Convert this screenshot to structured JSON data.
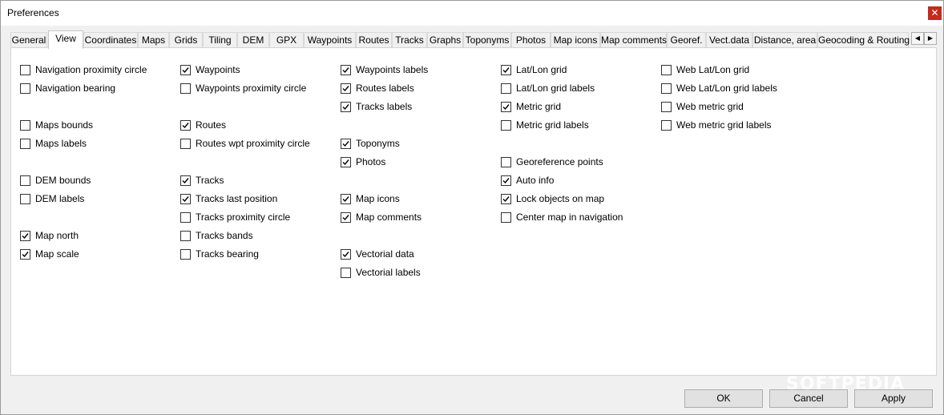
{
  "window": {
    "title": "Preferences",
    "close_glyph": "✕"
  },
  "tabs": [
    {
      "label": "General"
    },
    {
      "label": "View",
      "active": true
    },
    {
      "label": "Coordinates"
    },
    {
      "label": "Maps"
    },
    {
      "label": "Grids"
    },
    {
      "label": "Tiling"
    },
    {
      "label": "DEM"
    },
    {
      "label": "GPX"
    },
    {
      "label": "Waypoints"
    },
    {
      "label": "Routes"
    },
    {
      "label": "Tracks"
    },
    {
      "label": "Graphs"
    },
    {
      "label": "Toponyms"
    },
    {
      "label": "Photos"
    },
    {
      "label": "Map icons"
    },
    {
      "label": "Map comments"
    },
    {
      "label": "Georef."
    },
    {
      "label": "Vect.data"
    },
    {
      "label": "Distance, area"
    },
    {
      "label": "Geocoding & Routing"
    }
  ],
  "tab_scroll": {
    "left_glyph": "◀",
    "right_glyph": "▶"
  },
  "options": {
    "col1": [
      {
        "label": "Navigation proximity circle",
        "checked": false
      },
      {
        "label": "Navigation bearing",
        "checked": false
      },
      {
        "label": "Maps bounds",
        "checked": false
      },
      {
        "label": "Maps labels",
        "checked": false
      },
      {
        "label": "DEM bounds",
        "checked": false
      },
      {
        "label": "DEM labels",
        "checked": false
      },
      {
        "label": "Map north",
        "checked": true
      },
      {
        "label": "Map scale",
        "checked": true
      }
    ],
    "col2": [
      {
        "label": "Waypoints",
        "checked": true
      },
      {
        "label": "Waypoints proximity circle",
        "checked": false
      },
      {
        "label": "Routes",
        "checked": true
      },
      {
        "label": "Routes wpt proximity circle",
        "checked": false
      },
      {
        "label": "Tracks",
        "checked": true
      },
      {
        "label": "Tracks last position",
        "checked": true
      },
      {
        "label": "Tracks proximity circle",
        "checked": false
      },
      {
        "label": "Tracks bands",
        "checked": false
      },
      {
        "label": "Tracks bearing",
        "checked": false
      }
    ],
    "col3": [
      {
        "label": "Waypoints labels",
        "checked": true
      },
      {
        "label": "Routes labels",
        "checked": true
      },
      {
        "label": "Tracks labels",
        "checked": true
      },
      {
        "label": "Toponyms",
        "checked": true
      },
      {
        "label": "Photos",
        "checked": true
      },
      {
        "label": "Map icons",
        "checked": true
      },
      {
        "label": "Map comments",
        "checked": true
      },
      {
        "label": "Vectorial data",
        "checked": true
      },
      {
        "label": "Vectorial labels",
        "checked": false
      }
    ],
    "col4": [
      {
        "label": "Lat/Lon grid",
        "checked": true
      },
      {
        "label": "Lat/Lon grid labels",
        "checked": false
      },
      {
        "label": "Metric grid",
        "checked": true
      },
      {
        "label": "Metric grid labels",
        "checked": false
      },
      {
        "label": "Georeference points",
        "checked": false
      },
      {
        "label": "Auto info",
        "checked": true
      },
      {
        "label": "Lock objects on map",
        "checked": true
      },
      {
        "label": "Center map in navigation",
        "checked": false
      }
    ],
    "col5": [
      {
        "label": "Web Lat/Lon grid",
        "checked": false
      },
      {
        "label": "Web Lat/Lon grid labels",
        "checked": false
      },
      {
        "label": "Web metric grid",
        "checked": false
      },
      {
        "label": "Web metric grid labels",
        "checked": false
      }
    ]
  },
  "buttons": {
    "ok": "OK",
    "cancel": "Cancel",
    "apply": "Apply"
  },
  "watermark": "SOFTPEDIA",
  "colors": {
    "close": "#c42b1c",
    "panel": "#ffffff",
    "background": "#f0f0f0"
  }
}
